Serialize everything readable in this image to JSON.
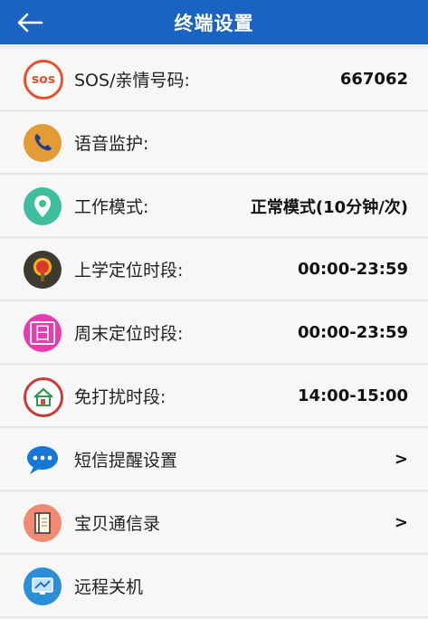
{
  "header": {
    "title": "终端设置",
    "back_icon": "arrow-left-icon"
  },
  "colors": {
    "header_bg": "#1a63c3"
  },
  "items": [
    {
      "key": "sos",
      "label": "SOS/亲情号码:",
      "value": "667062",
      "icon": "sos-icon",
      "icon_text": "sos"
    },
    {
      "key": "voice",
      "label": "语音监护:",
      "value": "",
      "icon": "phone-icon"
    },
    {
      "key": "mode",
      "label": "工作模式:",
      "value": "正常模式(10分钟/次)",
      "icon": "location-pin-icon"
    },
    {
      "key": "school",
      "label": "上学定位时段:",
      "value": "00:00-23:59",
      "icon": "tree-icon"
    },
    {
      "key": "weekend",
      "label": "周末定位时段:",
      "value": "00:00-23:59",
      "icon": "calendar-icon",
      "icon_text": "日"
    },
    {
      "key": "dnd",
      "label": "免打扰时段:",
      "value": "14:00-15:00",
      "icon": "house-icon"
    },
    {
      "key": "sms",
      "label": "短信提醒设置",
      "value": ">",
      "icon": "chat-bubble-icon"
    },
    {
      "key": "contacts",
      "label": "宝贝通信录",
      "value": ">",
      "icon": "address-book-icon"
    },
    {
      "key": "shutdown",
      "label": "远程关机",
      "value": "",
      "icon": "monitor-icon"
    }
  ]
}
